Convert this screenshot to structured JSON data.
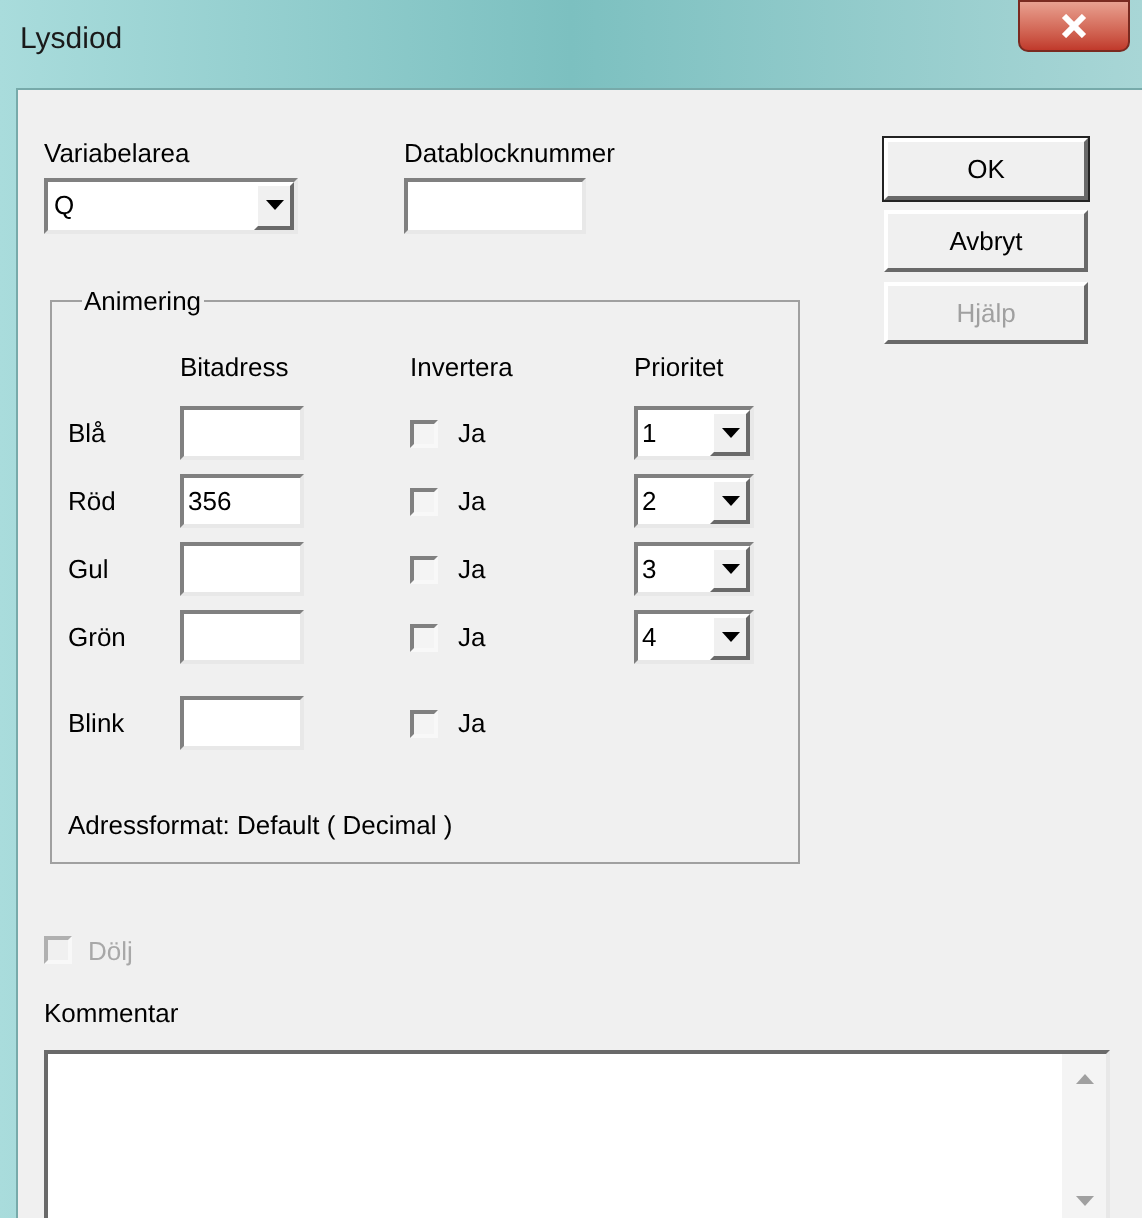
{
  "window": {
    "title": "Lysdiod"
  },
  "variabelarea": {
    "label": "Variabelarea",
    "value": "Q"
  },
  "datablocknummer": {
    "label": "Datablocknummer"
  },
  "buttons": [
    {
      "label": "OK",
      "disabled": false
    },
    {
      "label": "Avbryt",
      "disabled": false
    },
    {
      "label": "Hjälp",
      "disabled": true
    }
  ],
  "animering": {
    "title": "Animering",
    "columns": [
      "Bitadress",
      "Invertera",
      "Prioritet"
    ],
    "rows": [
      {
        "label": "Blå",
        "invert_label": "Ja",
        "inverted": false,
        "priority": "1"
      },
      {
        "label": "Röd",
        "bitadress": "356",
        "invert_label": "Ja",
        "inverted": false,
        "priority": "2"
      },
      {
        "label": "Gul",
        "invert_label": "Ja",
        "inverted": false,
        "priority": "3"
      },
      {
        "label": "Grön",
        "invert_label": "Ja",
        "inverted": false,
        "priority": "4"
      },
      {
        "label": "Blink",
        "invert_label": "Ja",
        "inverted": false
      }
    ],
    "address_format": "Adressformat: Default ( Decimal )"
  },
  "hide": {
    "label": "Dölj",
    "checked": false,
    "disabled": true
  },
  "comment": {
    "label": "Kommentar"
  }
}
